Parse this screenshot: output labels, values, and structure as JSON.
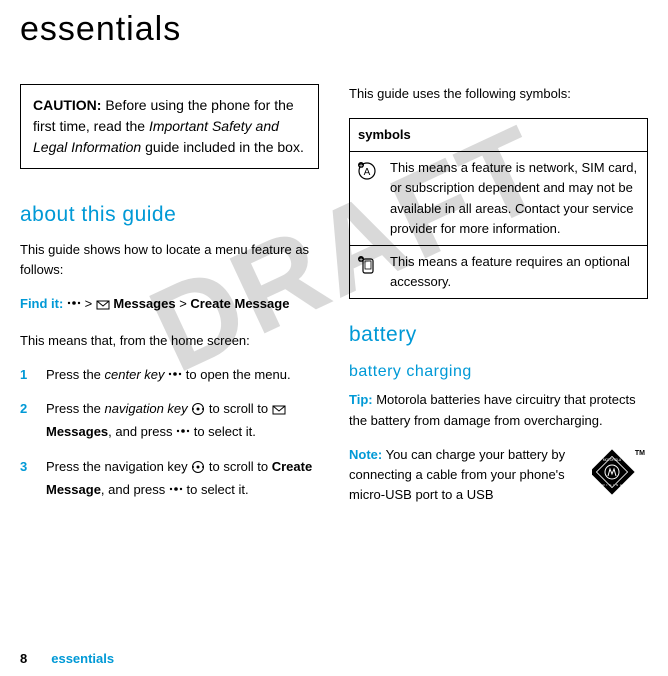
{
  "title": "essentials",
  "watermark": "DRAFT",
  "caution": {
    "label": "CAUTION:",
    "text_before": " Before using the phone for the first time, read the ",
    "italic": "Important Safety and Legal Information",
    "text_after": " guide included in the box."
  },
  "about_heading": "about this guide",
  "about_intro": "This guide shows how to locate a menu feature as follows:",
  "findit": {
    "label": "Find it:",
    "sep1": " > ",
    "msg": "Messages",
    "sep2": " > ",
    "create": "Create Message"
  },
  "home_intro": "This means that, from the home screen:",
  "steps": {
    "s1": {
      "num": "1",
      "a": "Press the ",
      "it": "center key",
      "b": " to open the menu."
    },
    "s2": {
      "num": "2",
      "a": "Press the ",
      "it": "navigation key",
      "b": " to scroll to ",
      "bold": "Messages",
      "c": ", and press ",
      "d": " to select it."
    },
    "s3": {
      "num": "3",
      "a": "Press the navigation key ",
      "b": " to scroll to ",
      "bold": "Create Message",
      "c": ", and press ",
      "d": " to select it."
    }
  },
  "symbols_intro": "This guide uses the following symbols:",
  "symbols_header": "symbols",
  "symbols_row1": "This means a feature is network, SIM card, or subscription dependent and may not be available in all areas. Contact your service provider for more information.",
  "symbols_row2": "This means a feature requires an optional accessory.",
  "battery_heading": "battery",
  "charging_heading": "battery charging",
  "tip_label": "Tip:",
  "tip_text": " Motorola batteries have circuitry that protects the battery from damage from overcharging.",
  "note_label": "Note:",
  "note_text": " You can charge your battery by connecting a cable from your phone's micro-USB port to a USB",
  "tm": "TM",
  "moto_top": "MOTOROLA",
  "moto_bottom": "O R I G I N A L",
  "footer_page": "8",
  "footer_section": "essentials"
}
